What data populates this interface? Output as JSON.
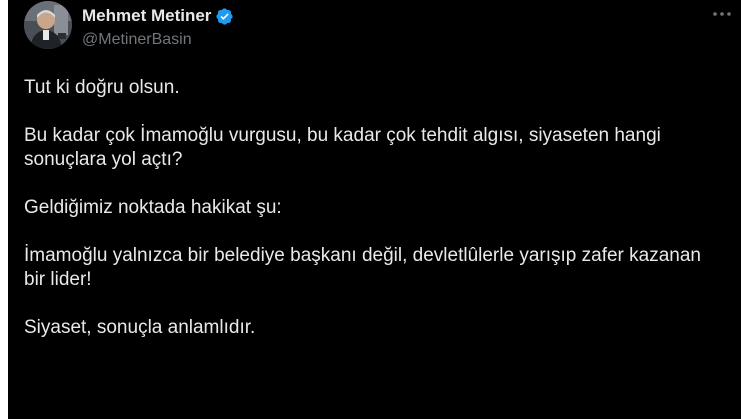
{
  "author": {
    "display_name": "Mehmet Metiner",
    "handle": "@MetinerBasin",
    "verified": true
  },
  "icons": {
    "verified": "verified-badge-icon",
    "more": "more-options-icon"
  },
  "colors": {
    "background": "#000000",
    "text": "#e7e9ea",
    "secondary_text": "#71767b",
    "verified_badge": "#1d9bf0"
  },
  "tweet": {
    "paragraphs": [
      "Tut ki doğru olsun.",
      "Bu kadar çok İmamoğlu vurgusu, bu kadar çok tehdit algısı, siyaseten hangi sonuçlara yol açtı?",
      "Geldiğimiz noktada hakikat şu:",
      "İmamoğlu yalnızca bir belediye başkanı değil, devletlûlerle yarışıp zafer kazanan bir lider!",
      "Siyaset, sonuçla anlamlıdır."
    ]
  }
}
